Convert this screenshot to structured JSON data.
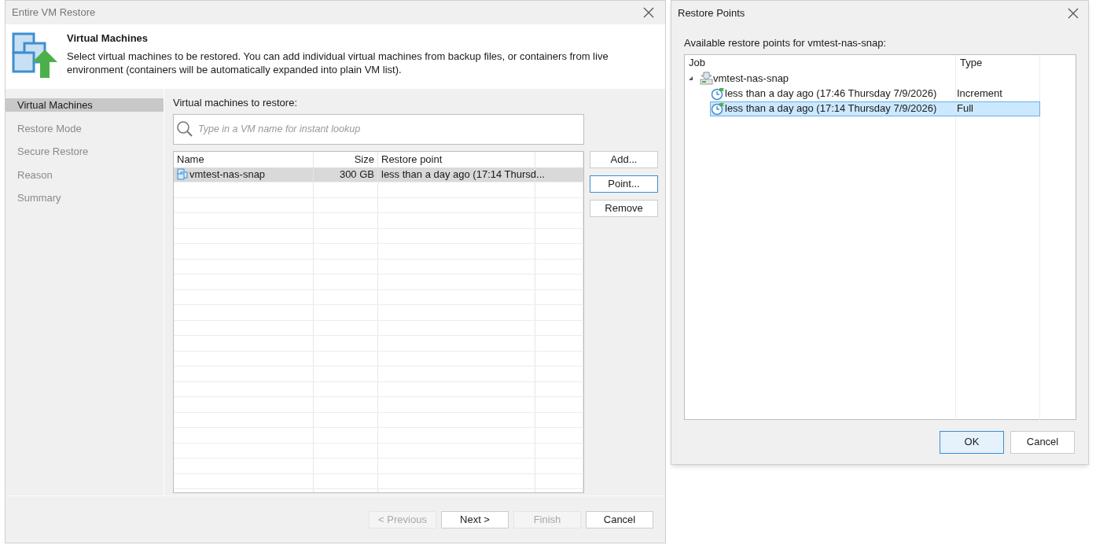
{
  "wizard": {
    "title": "Entire VM Restore",
    "header": {
      "title": "Virtual Machines",
      "description": "Select virtual machines to be restored. You can add individual virtual machines from backup files, or containers from live environment (containers will be automatically expanded into plain VM list)."
    },
    "steps": [
      {
        "label": "Virtual Machines",
        "selected": true
      },
      {
        "label": "Restore Mode",
        "selected": false
      },
      {
        "label": "Secure Restore",
        "selected": false
      },
      {
        "label": "Reason",
        "selected": false
      },
      {
        "label": "Summary",
        "selected": false
      }
    ],
    "list_label": "Virtual machines to restore:",
    "search": {
      "placeholder": "Type in a VM name for instant lookup"
    },
    "table": {
      "columns": [
        "Name",
        "Size",
        "Restore point"
      ],
      "rows": [
        {
          "name": "vmtest-nas-snap",
          "size": "300 GB",
          "restore_point": "less than a day ago (17:14 Thursd...",
          "selected": true
        }
      ]
    },
    "side_buttons": [
      {
        "label": "Add...",
        "focused": false
      },
      {
        "label": "Point...",
        "focused": true
      },
      {
        "label": "Remove",
        "focused": false
      }
    ],
    "footer_buttons": [
      {
        "label": "< Previous",
        "disabled": true
      },
      {
        "label": "Next >",
        "disabled": false
      },
      {
        "label": "Finish",
        "disabled": true
      },
      {
        "label": "Cancel",
        "disabled": false
      }
    ]
  },
  "restore_points": {
    "title": "Restore Points",
    "label": "Available restore points for vmtest-nas-snap:",
    "columns": [
      "Job",
      "Type"
    ],
    "job": {
      "name": "vmtest-nas-snap",
      "expanded": true,
      "children": [
        {
          "label": "less than a day ago (17:46 Thursday 7/9/2026)",
          "type": "Increment",
          "selected": false
        },
        {
          "label": "less than a day ago (17:14 Thursday 7/9/2026)",
          "type": "Full",
          "selected": true
        }
      ]
    },
    "buttons": [
      {
        "label": "OK",
        "default": true
      },
      {
        "label": "Cancel",
        "default": false
      }
    ]
  }
}
